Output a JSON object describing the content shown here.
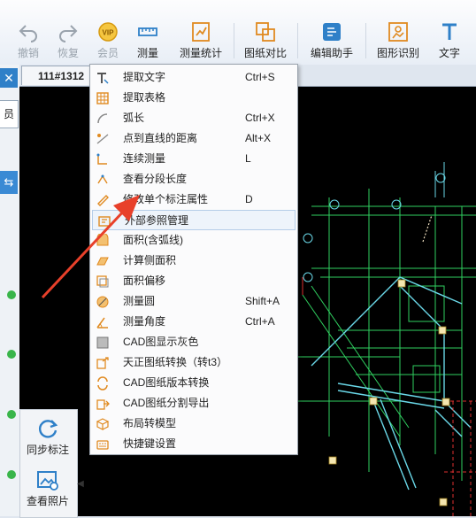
{
  "toolbar": {
    "buttons": [
      {
        "label": "撤销",
        "icon": "undo-icon"
      },
      {
        "label": "恢复",
        "icon": "redo-icon"
      },
      {
        "label": "会员",
        "icon": "vip-icon"
      },
      {
        "label": "测量",
        "icon": "measure-icon"
      },
      {
        "label": "测量统计",
        "icon": "measure-stats-icon"
      },
      {
        "label": "图纸对比",
        "icon": "drawing-compare-icon"
      },
      {
        "label": "编辑助手",
        "icon": "edit-assistant-icon"
      },
      {
        "label": "图形识别",
        "icon": "shape-recognize-icon"
      },
      {
        "label": "文字",
        "icon": "text-icon"
      }
    ]
  },
  "left_panel": {
    "close": "✕",
    "tab_label": "员",
    "sync_icon": "⇆"
  },
  "document": {
    "tab_title": "111#1312"
  },
  "side_actions": {
    "sync_label": "同步标注",
    "photo_label": "查看照片",
    "collapse": "◀"
  },
  "menu": {
    "items": [
      {
        "label": "提取文字",
        "shortcut": "Ctrl+S",
        "icon": "extract-text-icon"
      },
      {
        "label": "提取表格",
        "shortcut": "",
        "icon": "extract-table-icon"
      },
      {
        "label": "弧长",
        "shortcut": "Ctrl+X",
        "icon": "arc-length-icon"
      },
      {
        "label": "点到直线的距离",
        "shortcut": "Alt+X",
        "icon": "point-line-distance-icon"
      },
      {
        "label": "连续测量",
        "shortcut": "L",
        "icon": "continuous-measure-icon"
      },
      {
        "label": "查看分段长度",
        "shortcut": "",
        "icon": "segment-length-icon"
      },
      {
        "label": "修改单个标注属性",
        "shortcut": "D",
        "icon": "edit-annotation-icon"
      },
      {
        "label": "外部参照管理",
        "shortcut": "",
        "icon": "xref-manage-icon"
      },
      {
        "label": "面积(含弧线)",
        "shortcut": "",
        "icon": "area-arc-icon"
      },
      {
        "label": "计算侧面积",
        "shortcut": "",
        "icon": "side-area-icon"
      },
      {
        "label": "面积偏移",
        "shortcut": "",
        "icon": "area-offset-icon"
      },
      {
        "label": "测量圆",
        "shortcut": "Shift+A",
        "icon": "measure-circle-icon"
      },
      {
        "label": "测量角度",
        "shortcut": "Ctrl+A",
        "icon": "measure-angle-icon"
      },
      {
        "label": "CAD图显示灰色",
        "shortcut": "",
        "icon": "gray-display-icon"
      },
      {
        "label": "天正图纸转换（转t3）",
        "shortcut": "",
        "icon": "tangent-convert-icon"
      },
      {
        "label": "CAD图纸版本转换",
        "shortcut": "",
        "icon": "version-convert-icon"
      },
      {
        "label": "CAD图纸分割导出",
        "shortcut": "",
        "icon": "split-export-icon"
      },
      {
        "label": "布局转模型",
        "shortcut": "",
        "icon": "layout-to-model-icon"
      },
      {
        "label": "快捷键设置",
        "shortcut": "",
        "icon": "shortcut-settings-icon"
      }
    ],
    "highlighted_index": 7
  },
  "colors": {
    "accent": "#2f80c8",
    "annotation_arrow": "#e8402a",
    "cad_lines": "#30d060",
    "cad_cyan": "#6ad8e8",
    "cad_red": "#e03030"
  }
}
